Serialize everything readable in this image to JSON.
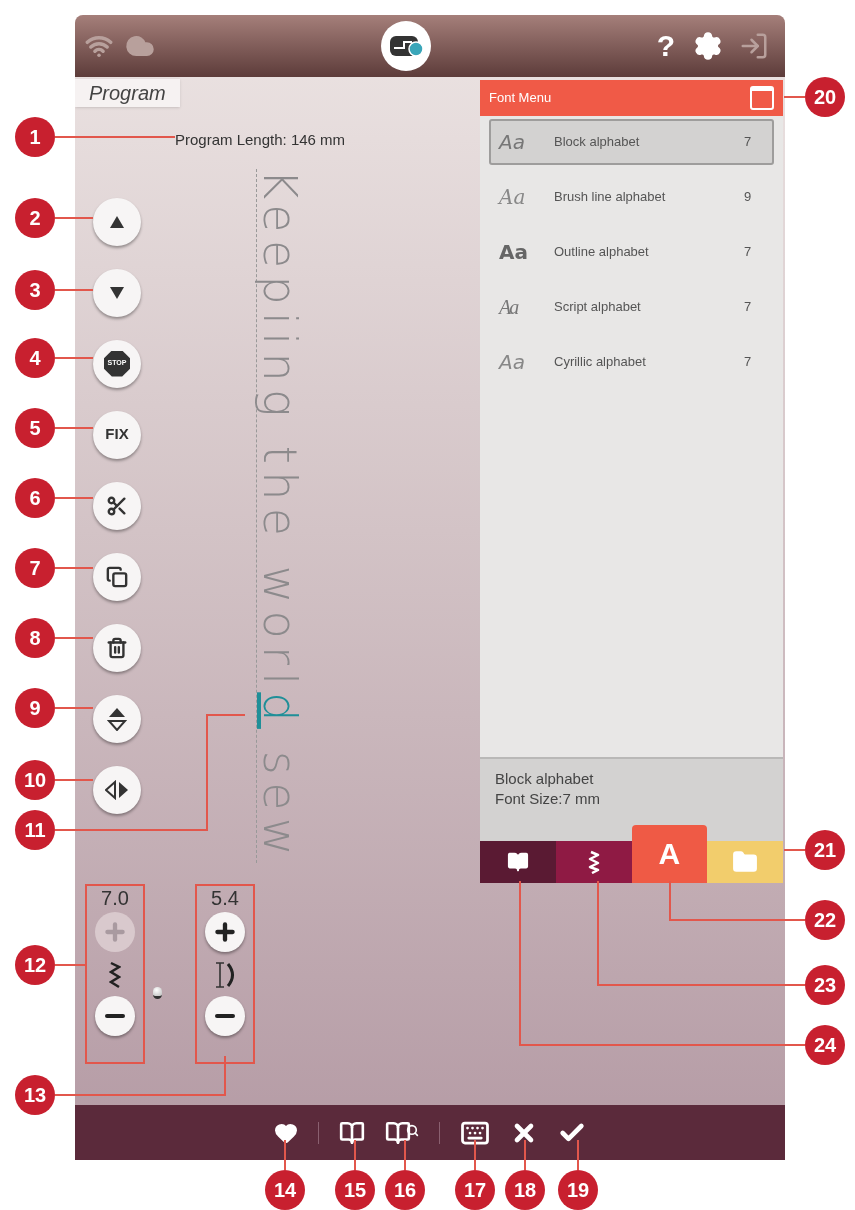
{
  "top_bar": {
    "help_label": "?"
  },
  "program_tab": "Program",
  "program_length": "Program Length: 146 mm",
  "stitch_text": {
    "before": "Keepiing the worl",
    "cursor": "d",
    "after": " sew"
  },
  "left_tools": [
    {
      "kind": "up"
    },
    {
      "kind": "down"
    },
    {
      "kind": "stop",
      "label": "STOP"
    },
    {
      "kind": "fix",
      "label": "FIX"
    },
    {
      "kind": "cut"
    },
    {
      "kind": "copy"
    },
    {
      "kind": "delete"
    },
    {
      "kind": "mirror_vertical"
    },
    {
      "kind": "mirror_horizontal"
    }
  ],
  "adjusters": [
    {
      "kind": "width",
      "value": "7.0",
      "plus_disabled": true
    },
    {
      "kind": "density",
      "value": "5.4",
      "plus_disabled": false
    }
  ],
  "font_menu": {
    "title": "Font Menu",
    "items": [
      {
        "kind": "block",
        "sample": "Aa",
        "name": "Block alphabet",
        "count": "7",
        "selected": true
      },
      {
        "kind": "brush",
        "sample": "Aa",
        "name": "Brush line alphabet",
        "count": "9",
        "selected": false
      },
      {
        "kind": "outline",
        "sample": "Aa",
        "name": "Outline alphabet",
        "count": "7",
        "selected": false
      },
      {
        "kind": "script",
        "sample": "Aa",
        "name": "Script alphabet",
        "count": "7",
        "selected": false
      },
      {
        "kind": "cyrillic",
        "sample": "Aa",
        "name": "Cyrillic alphabet",
        "count": "7",
        "selected": false
      }
    ],
    "info": [
      "Block alphabet",
      "Font Size:7 mm"
    ],
    "tabs": [
      {
        "kind": "book",
        "color": "#5a1a33",
        "selected": false
      },
      {
        "kind": "stitch",
        "color": "#8f1a44",
        "selected": false
      },
      {
        "kind": "font",
        "label": "A",
        "color": "#ef5a45",
        "selected": true
      },
      {
        "kind": "folder",
        "color": "#f2cd6c",
        "selected": false
      }
    ]
  },
  "bottom_bar": [
    {
      "kind": "heart"
    },
    {
      "kind": "separator"
    },
    {
      "kind": "book"
    },
    {
      "kind": "book_search"
    },
    {
      "kind": "separator"
    },
    {
      "kind": "keyboard"
    },
    {
      "kind": "close"
    },
    {
      "kind": "confirm"
    }
  ],
  "callouts": [
    "1",
    "2",
    "3",
    "4",
    "5",
    "6",
    "7",
    "8",
    "9",
    "10",
    "11",
    "12",
    "13",
    "14",
    "15",
    "16",
    "17",
    "18",
    "19",
    "20",
    "21",
    "22",
    "23",
    "24"
  ]
}
